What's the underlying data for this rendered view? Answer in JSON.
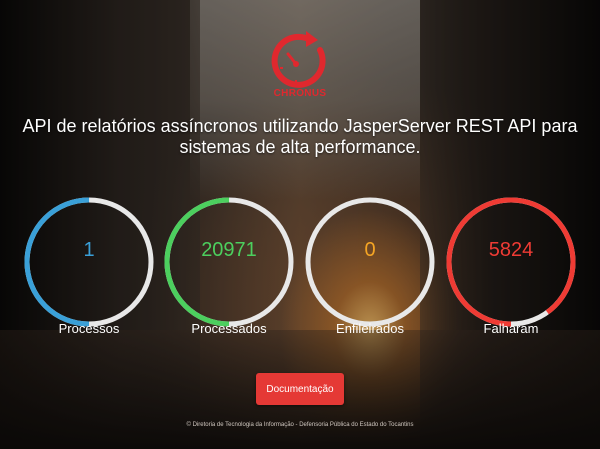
{
  "brand": {
    "name": "CHRONUS",
    "color": "#e0282e"
  },
  "headline": "API de relatórios assíncronos utilizando JasperServer REST API para sistemas de alta performance.",
  "stats": [
    {
      "value": "1",
      "label": "Processos",
      "color": "#3aa0d8",
      "fill": 0.5
    },
    {
      "value": "20971",
      "label": "Processados",
      "color": "#4ccf5e",
      "fill": 0.5
    },
    {
      "value": "0",
      "label": "Enfileirados",
      "color": "#f5a524",
      "fill": 0.0
    },
    {
      "value": "5824",
      "label": "Falharam",
      "color": "#ef3b34",
      "fill": 0.9
    }
  ],
  "doc_button": "Documentação",
  "footer": "© Diretoria de Tecnologia da Informação - Defensoria Pública do Estado do Tocantins"
}
